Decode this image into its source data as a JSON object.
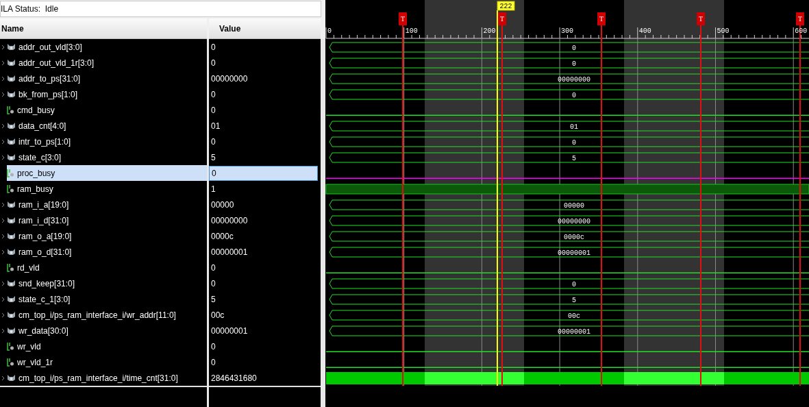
{
  "status": {
    "text": "ILA Status:  Idle"
  },
  "columns": {
    "name": "Name",
    "value": "Value"
  },
  "signals": [
    {
      "name": "addr_out_vld[3:0]",
      "value": "0",
      "kind": "bus",
      "selected": false,
      "wave_label": "0"
    },
    {
      "name": "addr_out_vld_1r[3:0]",
      "value": "0",
      "kind": "bus",
      "selected": false,
      "wave_label": "0"
    },
    {
      "name": "addr_to_ps[31:0]",
      "value": "00000000",
      "kind": "bus",
      "selected": false,
      "wave_label": "00000000"
    },
    {
      "name": "bk_from_ps[1:0]",
      "value": "0",
      "kind": "bus",
      "selected": false,
      "wave_label": "0"
    },
    {
      "name": "cmd_busy",
      "value": "0",
      "kind": "bit",
      "selected": false,
      "high": false
    },
    {
      "name": "data_cnt[4:0]",
      "value": "01",
      "kind": "bus",
      "selected": false,
      "wave_label": "01"
    },
    {
      "name": "intr_to_ps[1:0]",
      "value": "0",
      "kind": "bus",
      "selected": false,
      "wave_label": "0"
    },
    {
      "name": "state_c[3:0]",
      "value": "5",
      "kind": "bus",
      "selected": false,
      "wave_label": "5"
    },
    {
      "name": "proc_busy",
      "value": "0",
      "kind": "bit",
      "selected": true,
      "high": false
    },
    {
      "name": "ram_busy",
      "value": "1",
      "kind": "bit",
      "selected": false,
      "high": true
    },
    {
      "name": "ram_i_a[19:0]",
      "value": "00000",
      "kind": "bus",
      "selected": false,
      "wave_label": "00000"
    },
    {
      "name": "ram_i_d[31:0]",
      "value": "00000000",
      "kind": "bus",
      "selected": false,
      "wave_label": "00000000"
    },
    {
      "name": "ram_o_a[19:0]",
      "value": "0000c",
      "kind": "bus",
      "selected": false,
      "wave_label": "0000c"
    },
    {
      "name": "ram_o_d[31:0]",
      "value": "00000001",
      "kind": "bus",
      "selected": false,
      "wave_label": "00000001"
    },
    {
      "name": "rd_vld",
      "value": "0",
      "kind": "bit",
      "selected": false,
      "high": false
    },
    {
      "name": "snd_keep[31:0]",
      "value": "0",
      "kind": "bus",
      "selected": false,
      "wave_label": "0"
    },
    {
      "name": "state_c_1[3:0]",
      "value": "5",
      "kind": "bus",
      "selected": false,
      "wave_label": "5"
    },
    {
      "name": "cm_top_i/ps_ram_interface_i/wr_addr[11:0]",
      "value": "00c",
      "kind": "bus",
      "selected": false,
      "wave_label": "00c"
    },
    {
      "name": "wr_data[30:0]",
      "value": "00000001",
      "kind": "bus",
      "selected": false,
      "wave_label": "00000001"
    },
    {
      "name": "wr_vld",
      "value": "0",
      "kind": "bit",
      "selected": false,
      "high": false
    },
    {
      "name": "wr_vld_1r",
      "value": "0",
      "kind": "bit",
      "selected": false,
      "high": false
    },
    {
      "name": "cm_top_i/ps_ram_interface_i/time_cnt[31:0]",
      "value": "2846431680",
      "kind": "counter",
      "selected": false
    }
  ],
  "waveform": {
    "ruler_labels": [
      "0",
      "100",
      "200",
      "300",
      "400",
      "500",
      "600"
    ],
    "cursor": {
      "label": "222"
    },
    "triggers": [
      "T",
      "T",
      "T",
      "T",
      "T"
    ]
  }
}
